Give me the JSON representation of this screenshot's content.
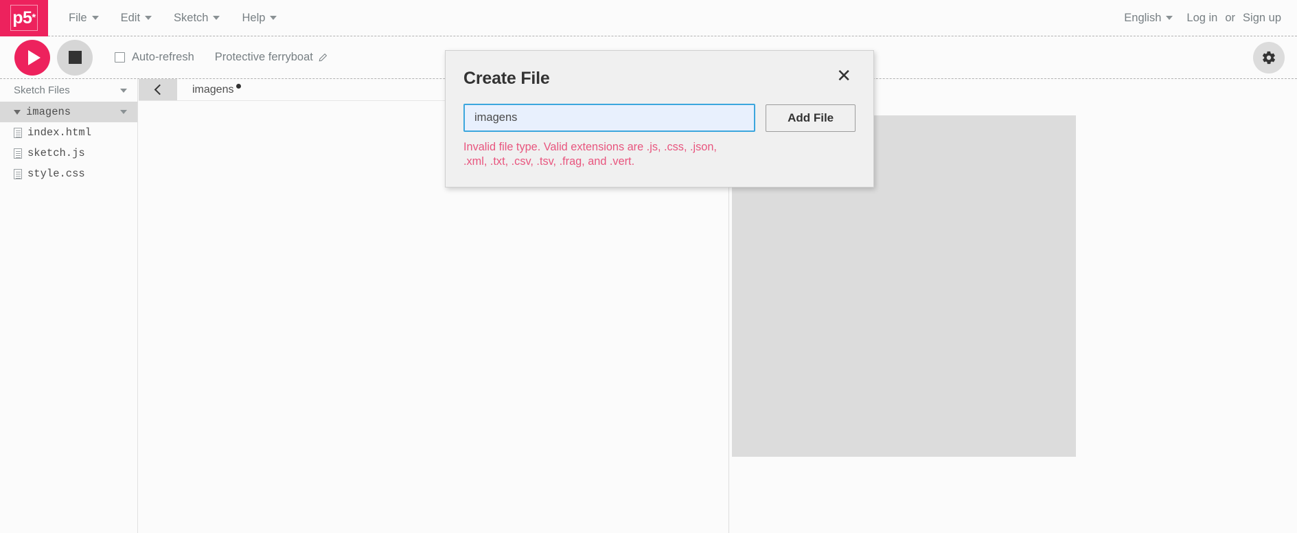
{
  "nav": {
    "logo_text": "p5",
    "logo_sup": "*",
    "menu": [
      {
        "label": "File",
        "icon": "chevron-down-icon"
      },
      {
        "label": "Edit",
        "icon": "chevron-down-icon"
      },
      {
        "label": "Sketch",
        "icon": "chevron-down-icon"
      },
      {
        "label": "Help",
        "icon": "chevron-down-icon"
      }
    ],
    "language": "English",
    "login": "Log in",
    "or": "or",
    "signup": "Sign up"
  },
  "toolbar": {
    "play_icon": "play-icon",
    "stop_icon": "stop-icon",
    "autorefresh_label": "Auto-refresh",
    "autorefresh_checked": false,
    "sketch_name": "Protective ferryboat",
    "edit_icon": "pencil-icon",
    "settings_icon": "gear-icon"
  },
  "sidebar": {
    "header": "Sketch Files",
    "header_icon": "chevron-down-icon",
    "items": [
      {
        "name": "imagens",
        "type": "folder",
        "selected": true,
        "expanded": true
      },
      {
        "name": "index.html",
        "type": "file",
        "selected": false
      },
      {
        "name": "sketch.js",
        "type": "file",
        "selected": false
      },
      {
        "name": "style.css",
        "type": "file",
        "selected": false
      }
    ]
  },
  "editor": {
    "back_icon": "chevron-left-icon",
    "tab_label": "imagens",
    "tab_unsaved": true,
    "content": ""
  },
  "preview": {
    "canvas_color": "#dcdcdc"
  },
  "modal": {
    "title": "Create File",
    "close_icon": "close-icon",
    "input_value": "imagens",
    "input_placeholder": "Name",
    "submit_label": "Add File",
    "error": "Invalid file type. Valid extensions are .js, .css, .json, .xml, .txt, .csv, .tsv, .frag, and .vert."
  },
  "colors": {
    "brand": "#ed225d",
    "error": "#e8557e",
    "focus_border": "#3ba6dd",
    "muted_text": "#777f83"
  }
}
